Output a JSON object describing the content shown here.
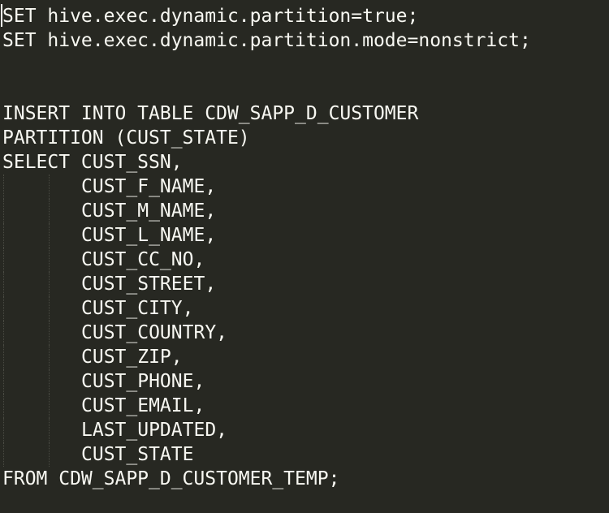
{
  "editor": {
    "lines": [
      "SET hive.exec.dynamic.partition=true;",
      "SET hive.exec.dynamic.partition.mode=nonstrict;",
      "",
      "",
      "INSERT INTO TABLE CDW_SAPP_D_CUSTOMER",
      "PARTITION (CUST_STATE)",
      "SELECT CUST_SSN,",
      "CUST_F_NAME,",
      "CUST_M_NAME,",
      "CUST_L_NAME,",
      "CUST_CC_NO,",
      "CUST_STREET,",
      "CUST_CITY,",
      "CUST_COUNTRY,",
      "CUST_ZIP,",
      "CUST_PHONE,",
      "CUST_EMAIL,",
      "LAST_UPDATED,",
      "CUST_STATE",
      "FROM CDW_SAPP_D_CUSTOMER_TEMP;"
    ]
  },
  "colors": {
    "background": "#272822",
    "text": "#f8f8f2",
    "indent_guide": "#4a4b43"
  }
}
